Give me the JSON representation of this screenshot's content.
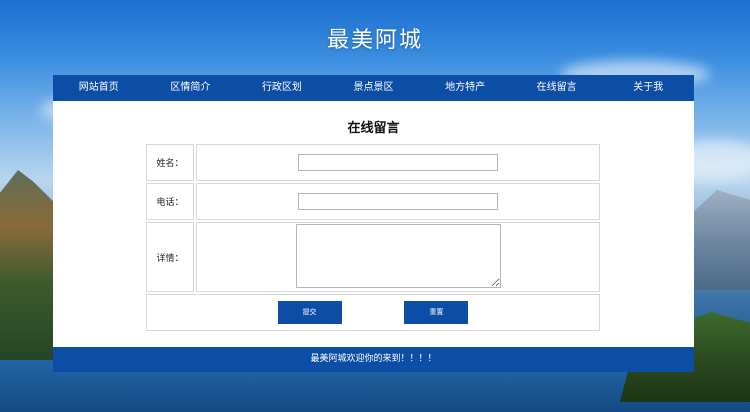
{
  "site": {
    "title": "最美阿城"
  },
  "nav": {
    "items": [
      {
        "label": "网站首页"
      },
      {
        "label": "区情简介"
      },
      {
        "label": "行政区划"
      },
      {
        "label": "景点景区"
      },
      {
        "label": "地方特产"
      },
      {
        "label": "在线留言"
      },
      {
        "label": "关于我"
      }
    ]
  },
  "form": {
    "title": "在线留言",
    "name_label": "姓名：",
    "name_value": "",
    "phone_label": "电话：",
    "phone_value": "",
    "detail_label": "详情：",
    "detail_value": "",
    "submit_label": "提交",
    "reset_label": "重置"
  },
  "footer": {
    "text": "最美阿城欢迎你的来到！！！！"
  },
  "colors": {
    "primary": "#0c4ea5",
    "panel": "#ffffff"
  }
}
